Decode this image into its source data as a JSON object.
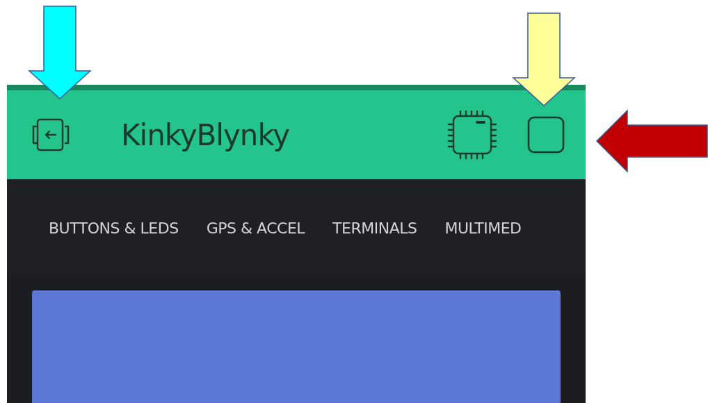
{
  "app_bar": {
    "title": "KinkyBlynky"
  },
  "tabs": [
    {
      "label": "BUTTONS & LEDS"
    },
    {
      "label": "GPS & ACCEL"
    },
    {
      "label": "TERMINALS"
    },
    {
      "label": "MULTIMED"
    }
  ],
  "annotations": [
    {
      "kind": "down",
      "color": "#00ffff"
    },
    {
      "kind": "down",
      "color": "#ffff99"
    },
    {
      "kind": "left",
      "color": "#c00000"
    }
  ]
}
